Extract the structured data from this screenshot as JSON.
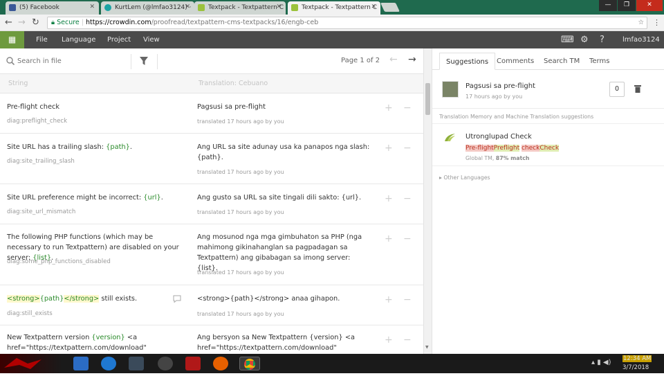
{
  "browser": {
    "tabs": [
      {
        "title": "(5) Facebook",
        "color": "#3b5998"
      },
      {
        "title": "KurtLem (@lmfao3124) ·",
        "color": "#1aa3a3"
      },
      {
        "title": "Textpack - Textpattern C",
        "color": "#9bc23c"
      },
      {
        "title": "Textpack - Textpattern C",
        "color": "#9bc23c"
      }
    ],
    "secure_label": "Secure",
    "url_host": "https://crowdin.com",
    "url_path": "/proofread/textpattern-cms-textpacks/16/engb-ceb"
  },
  "app": {
    "menu": [
      "File",
      "Language",
      "Project",
      "View"
    ],
    "username": "lmfao3124",
    "accent": "#6e9a3e"
  },
  "editor": {
    "search_placeholder": "Search in file",
    "page_label": "Page 1 of 2",
    "col_string": "String",
    "col_translation": "Translation: Cebuano",
    "rows": [
      {
        "key": "diag:preflight_check",
        "meta": "translated 17 hours ago by you"
      },
      {
        "key": "diag:site_trailing_slash",
        "meta": "translated 17 hours ago by you"
      },
      {
        "key": "diag:site_url_mismatch",
        "meta": "translated 17 hours ago by you"
      },
      {
        "key": "diag:some_php_functions_disabled",
        "meta": "translated 17 hours ago by you"
      },
      {
        "key": "diag:still_exists",
        "meta": "translated 17 hours ago by you"
      },
      {
        "key": "",
        "meta": ""
      }
    ],
    "texts": {
      "r0_src": "Pre-flight check",
      "r0_tr": "Pagsusi sa pre-flight",
      "r1_src": "Site URL has a trailing slash: ",
      "r1_ph": "{path}",
      "r1_end": ".",
      "r1_tr": "Ang URL sa site adunay usa ka panapos nga slash: {path}.",
      "r2_src": "Site URL preference might be incorrect: ",
      "r2_ph": "{url}",
      "r2_end": ".",
      "r2_tr": "Ang gusto sa URL sa site tingali dili sakto: {url}.",
      "r3_src": "The following PHP functions (which may be necessary to run Textpattern) are disabled on your server: ",
      "r3_ph": "{list}",
      "r3_end": ".",
      "r3_tr": "Ang mosunod nga mga gimbuhaton sa PHP (nga mahimong gikinahanglan sa pagpadagan sa Textpattern) ang gibabagan sa imong server: {list}.",
      "r4_tag1": "<strong>",
      "r4_ph": "{path}",
      "r4_tag2": "</strong>",
      "r4_end": " still exists.",
      "r4_tr": "<strong>{path}</strong> anaa gihapon.",
      "r5_src": "New Textpattern version ",
      "r5_ph": "{version}",
      "r5_mid": " <a href=\"https://textpattern.com/download\"",
      "r5_tr": "Ang bersyon sa New Textpattern {version} <a href=\"https://textpattern.com/download\""
    }
  },
  "panel": {
    "tabs": [
      "Suggestions",
      "Comments",
      "Search TM",
      "Terms"
    ],
    "own_translation": "Pagsusi sa pre-flight",
    "own_meta": "17 hours ago by you",
    "votes": "0",
    "tm_heading": "Translation Memory and Machine Translation suggestions",
    "tm_title": "Utronglupad Check",
    "diff_del1": "Pre-flight",
    "diff_ins1": "Preflight",
    "diff_del2": "check",
    "diff_ins2": "Check",
    "tm_source": "Global TM, ",
    "tm_match": "87% match",
    "other_languages": "Other Languages"
  },
  "taskbar": {
    "time": "12:34 AM",
    "date": "3/7/2018"
  }
}
